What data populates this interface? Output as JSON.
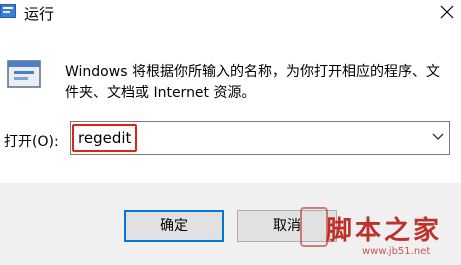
{
  "window": {
    "title": "运行",
    "close_icon": "close-icon",
    "app_icon": "run-dialog-icon"
  },
  "description": "Windows 将根据你所输入的名称，为你打开相应的程序、文件夹、文档或 Internet 资源。",
  "open_field": {
    "label": "打开(O):",
    "value": "regedit",
    "dropdown_icon": "chevron-down-icon"
  },
  "buttons": {
    "ok_label": "确定",
    "cancel_label": "取消"
  },
  "watermark": {
    "text": "脚本之家",
    "site": "www.jb51.net"
  },
  "colors": {
    "highlight": "#e0211c",
    "accent": "#0078d7",
    "footer_bg": "#f0f0f0",
    "watermark": "#c0302a"
  }
}
